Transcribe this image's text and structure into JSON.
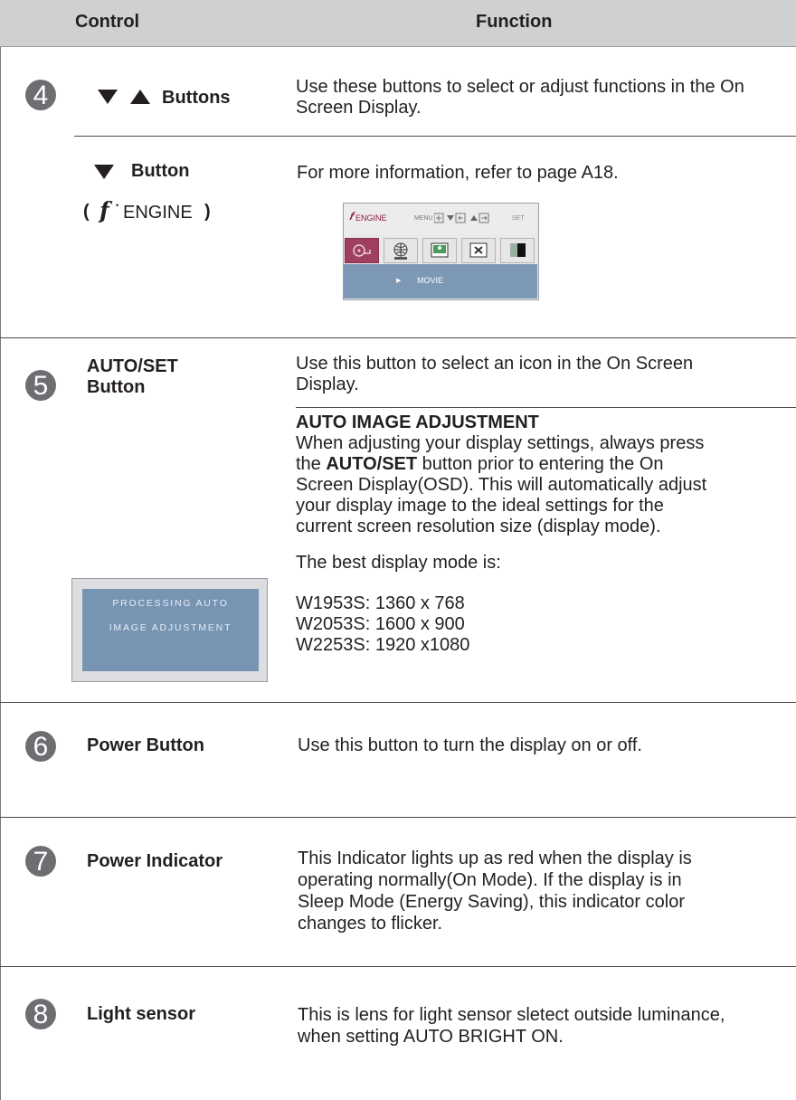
{
  "header": {
    "control": "Control",
    "function": "Function"
  },
  "item4": {
    "num": "4",
    "control_label": "Buttons",
    "function_text": [
      "Use these buttons to select or adjust functions in the On",
      "Screen Display."
    ],
    "sub_control_label": "Button",
    "sub_control_paren_open": "(",
    "sub_control_engine": "ENGINE",
    "sub_control_paren_close": ")",
    "sub_function_text": "For more information, refer to page A18.",
    "osd": {
      "title": "ENGINE",
      "menu_label": "MENU",
      "set_label": "SET",
      "mode": "MOVIE"
    }
  },
  "item5": {
    "num": "5",
    "control_label": [
      "AUTO/SET",
      "Button"
    ],
    "function_text": [
      "Use this button to select an icon in the On Screen",
      "Display."
    ],
    "auto_heading": "AUTO IMAGE ADJUSTMENT",
    "auto_l1": "When adjusting your display settings, always press",
    "auto_l2_pre": "the ",
    "auto_l2_bold": "AUTO/SET",
    "auto_l2_post": " button prior to entering the On",
    "auto_l3": "Screen Display(OSD). This will automatically adjust",
    "auto_l4": "your display image to the ideal settings for the",
    "auto_l5": "current screen resolution size (display mode).",
    "best_mode": "The best display mode is:",
    "modes": [
      "W1953S: 1360 x 768",
      "W2053S: 1600 x 900",
      "W2253S: 1920 x1080"
    ],
    "processing": [
      "PROCESSING AUTO",
      "IMAGE ADJUSTMENT"
    ]
  },
  "item6": {
    "num": "6",
    "control_label": "Power Button",
    "function_text": "Use this button to turn the display on or off."
  },
  "item7": {
    "num": "7",
    "control_label": "Power Indicator",
    "function_text": [
      "This Indicator lights up as red when the display is",
      "operating normally(On Mode). If the display is in",
      "Sleep Mode (Energy Saving), this indicator color",
      "changes to flicker."
    ]
  },
  "item8": {
    "num": "8",
    "control_label": "Light sensor",
    "function_text": [
      "This is lens for light sensor sletect outside luminance,",
      "when setting AUTO BRIGHT ON."
    ]
  },
  "colors": {
    "header_bg": "#cfd0d2",
    "badge": "#6d6e71",
    "osd_blue": "#7d98b4",
    "osd_selected": "#a04060"
  }
}
